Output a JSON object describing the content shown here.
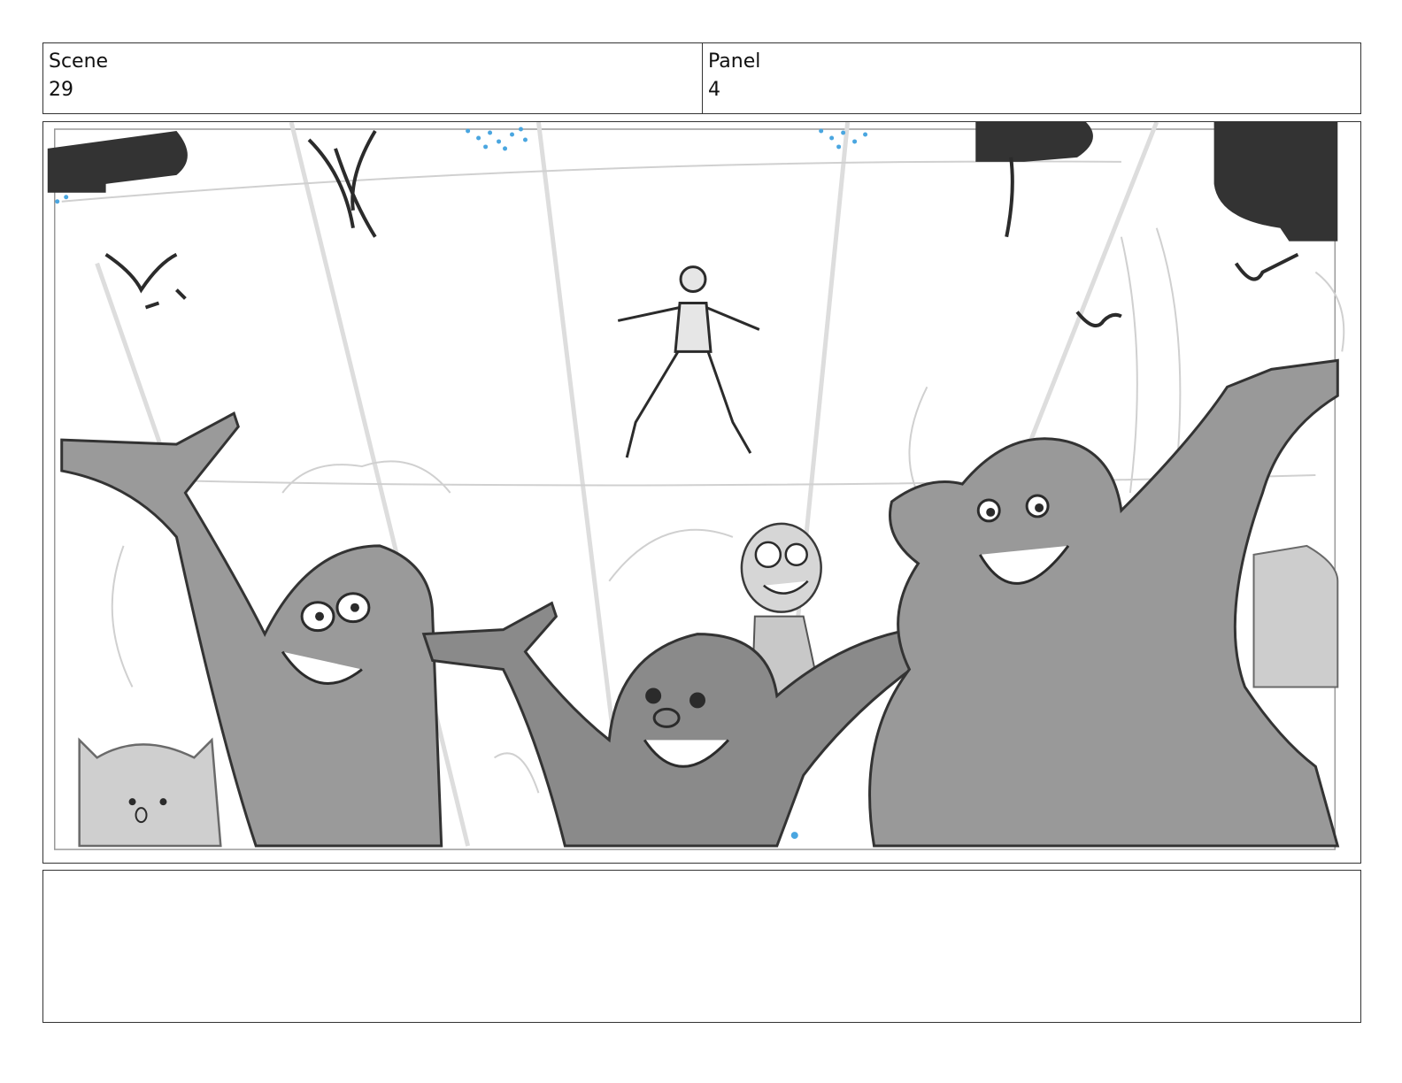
{
  "header": {
    "scene_label": "Scene",
    "scene_value": "29",
    "panel_label": "Panel",
    "panel_value": "4"
  },
  "notes": {
    "text": ""
  },
  "colors": {
    "sketch_dark": "#2b2b2b",
    "sketch_mid": "#8f8f8f",
    "sketch_light": "#c4c4c4",
    "confetti_blue": "#4aa6e0"
  }
}
